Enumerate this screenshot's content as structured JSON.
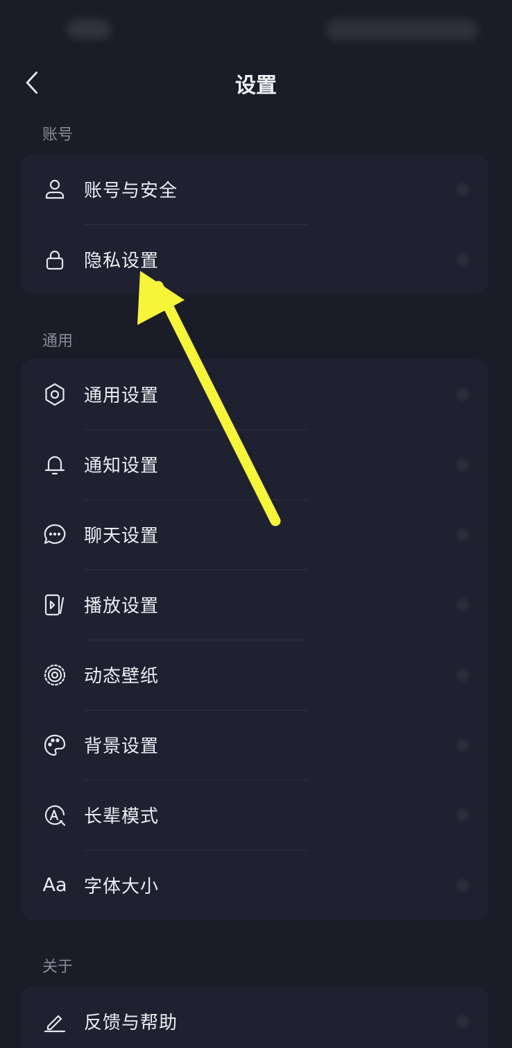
{
  "header": {
    "title": "设置",
    "back_icon": "chevron-left-icon"
  },
  "sections": {
    "account": {
      "label": "账号",
      "items": [
        {
          "label": "账号与安全",
          "icon": "user-icon"
        },
        {
          "label": "隐私设置",
          "icon": "lock-icon"
        }
      ]
    },
    "general": {
      "label": "通用",
      "items": [
        {
          "label": "通用设置",
          "icon": "gear-icon"
        },
        {
          "label": "通知设置",
          "icon": "bell-icon"
        },
        {
          "label": "聊天设置",
          "icon": "chat-icon"
        },
        {
          "label": "播放设置",
          "icon": "play-screen-icon"
        },
        {
          "label": "动态壁纸",
          "icon": "live-wallpaper-icon"
        },
        {
          "label": "背景设置",
          "icon": "palette-icon"
        },
        {
          "label": "长辈模式",
          "icon": "elder-mode-icon"
        },
        {
          "label": "字体大小",
          "icon": "font-size-icon",
          "icon_text": "Aa"
        }
      ]
    },
    "about": {
      "label": "关于",
      "items": [
        {
          "label": "反馈与帮助",
          "icon": "pencil-icon"
        }
      ]
    }
  },
  "annotation": {
    "arrow_color": "#f6f53a"
  },
  "colors": {
    "background": "#1a1c27",
    "card": "#1f2130",
    "text": "#eceef4",
    "section_label": "#8a8c99"
  }
}
